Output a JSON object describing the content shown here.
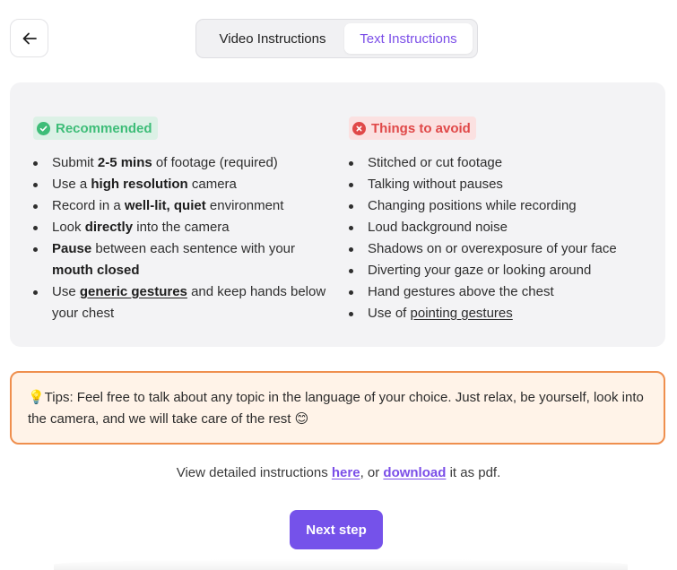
{
  "header": {
    "back_icon": "arrow-left-icon",
    "tabs": [
      {
        "label": "Video Instructions",
        "active": false
      },
      {
        "label": "Text Instructions",
        "active": true
      }
    ]
  },
  "recommended": {
    "title": "Recommended",
    "icon": "check-circle-icon",
    "color": "#3ebd78",
    "items": [
      {
        "parts": [
          {
            "t": "Submit "
          },
          {
            "t": "2-5 mins",
            "b": true
          },
          {
            "t": " of footage (required)"
          }
        ]
      },
      {
        "parts": [
          {
            "t": "Use a "
          },
          {
            "t": "high resolution",
            "b": true
          },
          {
            "t": " camera"
          }
        ]
      },
      {
        "parts": [
          {
            "t": "Record in a "
          },
          {
            "t": "well-lit, quiet",
            "b": true
          },
          {
            "t": " environment"
          }
        ]
      },
      {
        "parts": [
          {
            "t": "Look "
          },
          {
            "t": "directly",
            "b": true
          },
          {
            "t": " into the camera"
          }
        ]
      },
      {
        "parts": [
          {
            "t": "Pause",
            "b": true
          },
          {
            "t": " between each sentence with your "
          },
          {
            "t": "mouth closed",
            "b": true
          }
        ]
      },
      {
        "parts": [
          {
            "t": "Use "
          },
          {
            "t": "generic gestures",
            "b": true,
            "u": true
          },
          {
            "t": " and keep hands below your chest"
          }
        ]
      }
    ]
  },
  "avoid": {
    "title": "Things to avoid",
    "icon": "x-circle-icon",
    "color": "#e04848",
    "items": [
      {
        "parts": [
          {
            "t": "Stitched or cut footage"
          }
        ]
      },
      {
        "parts": [
          {
            "t": "Talking without pauses"
          }
        ]
      },
      {
        "parts": [
          {
            "t": "Changing positions while recording"
          }
        ]
      },
      {
        "parts": [
          {
            "t": "Loud background noise"
          }
        ]
      },
      {
        "parts": [
          {
            "t": "Shadows on or overexposure of your face"
          }
        ]
      },
      {
        "parts": [
          {
            "t": "Diverting your gaze or looking around"
          }
        ]
      },
      {
        "parts": [
          {
            "t": "Hand gestures above the chest"
          }
        ]
      },
      {
        "parts": [
          {
            "t": "Use of "
          },
          {
            "t": "pointing gestures",
            "u": true
          }
        ]
      }
    ]
  },
  "tips": {
    "text": "💡Tips: Feel free to talk about any topic in the language of your choice. Just relax, be yourself, look into the camera, and we will take care of the rest 😊"
  },
  "detail": {
    "prefix": "View detailed instructions ",
    "here_link": "here",
    "middle": ", or ",
    "download_link": "download",
    "suffix": " it as pdf."
  },
  "next_button": "Next step",
  "colors": {
    "accent": "#7552ea",
    "tab_active": "#7b4ee8",
    "tips_border": "#ef8f4e",
    "tips_bg": "#fff3e8"
  }
}
